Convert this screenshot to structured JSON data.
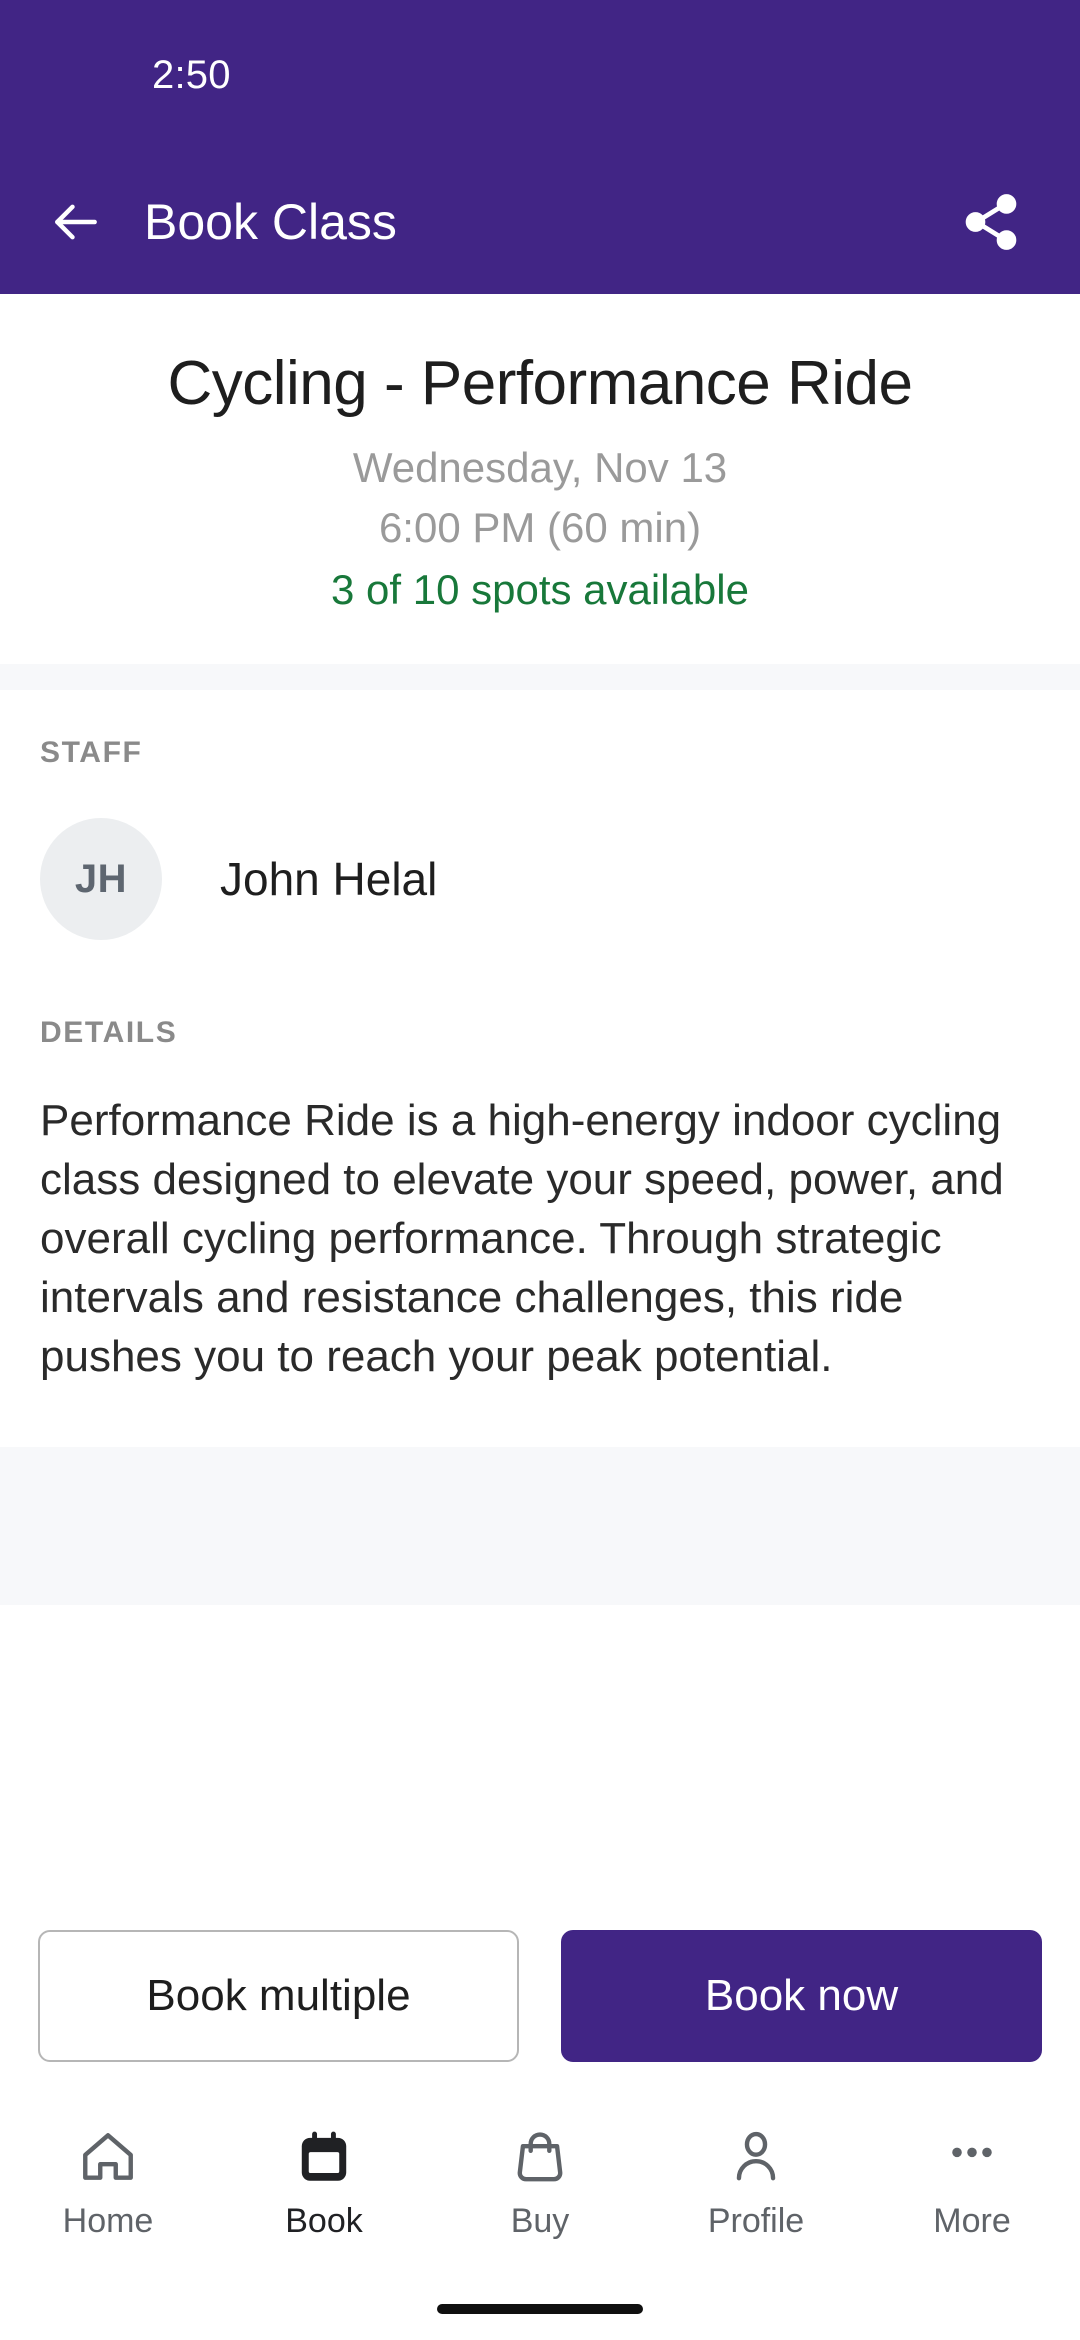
{
  "status_bar": {
    "time": "2:50"
  },
  "app_bar": {
    "back_icon": "arrow-left-icon",
    "title": "Book Class",
    "share_icon": "share-icon"
  },
  "class": {
    "title": "Cycling - Performance Ride",
    "date": "Wednesday, Nov 13",
    "time": "6:00 PM (60 min)",
    "spots": "3 of 10 spots available",
    "spots_color": "#18783a"
  },
  "staff": {
    "label": "STAFF",
    "initials": "JH",
    "name": "John Helal"
  },
  "details": {
    "label": "DETAILS",
    "text": "Performance Ride is a high-energy indoor cycling class designed to elevate your speed, power, and overall cycling performance. Through strategic intervals and resistance challenges, this ride pushes you to reach your peak potential."
  },
  "actions": {
    "secondary_label": "Book multiple",
    "primary_label": "Book now",
    "primary_color": "#412585"
  },
  "bottom_nav": {
    "items": [
      {
        "label": "Home",
        "icon": "home-icon",
        "active": false
      },
      {
        "label": "Book",
        "icon": "calendar-icon",
        "active": true
      },
      {
        "label": "Buy",
        "icon": "shopping-bag-icon",
        "active": false
      },
      {
        "label": "Profile",
        "icon": "person-icon",
        "active": false
      },
      {
        "label": "More",
        "icon": "ellipsis-icon",
        "active": false
      }
    ]
  },
  "theme": {
    "brand_purple": "#412585",
    "band_gray": "#f7f8fa",
    "avatar_gray": "#eceef0"
  }
}
